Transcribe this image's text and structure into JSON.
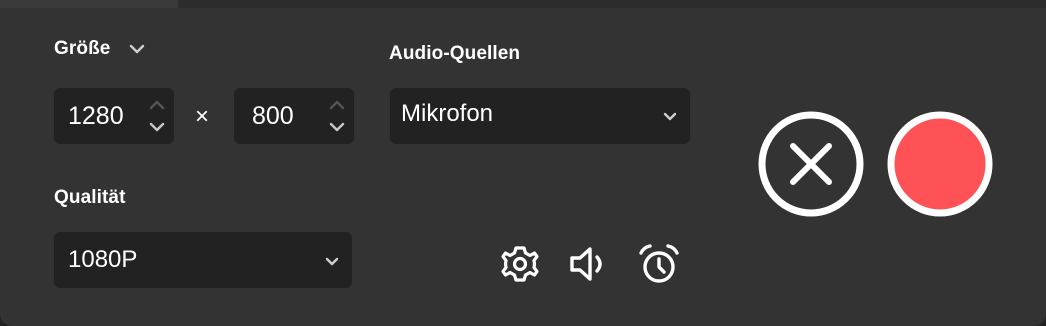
{
  "size": {
    "label": "Größe",
    "width": "1280",
    "height": "800",
    "times_symbol": "×"
  },
  "audio": {
    "label": "Audio-Quellen",
    "selected": "Mikrofon"
  },
  "quality": {
    "label": "Qualität",
    "selected": "1080P"
  },
  "icons": {
    "settings": "gear-icon",
    "audio": "speaker-icon",
    "schedule": "alarm-clock-icon",
    "cancel": "close-icon",
    "record": "record-icon"
  },
  "colors": {
    "panel": "#333333",
    "field": "#222222",
    "record": "#ff5257",
    "text": "#ffffff"
  }
}
